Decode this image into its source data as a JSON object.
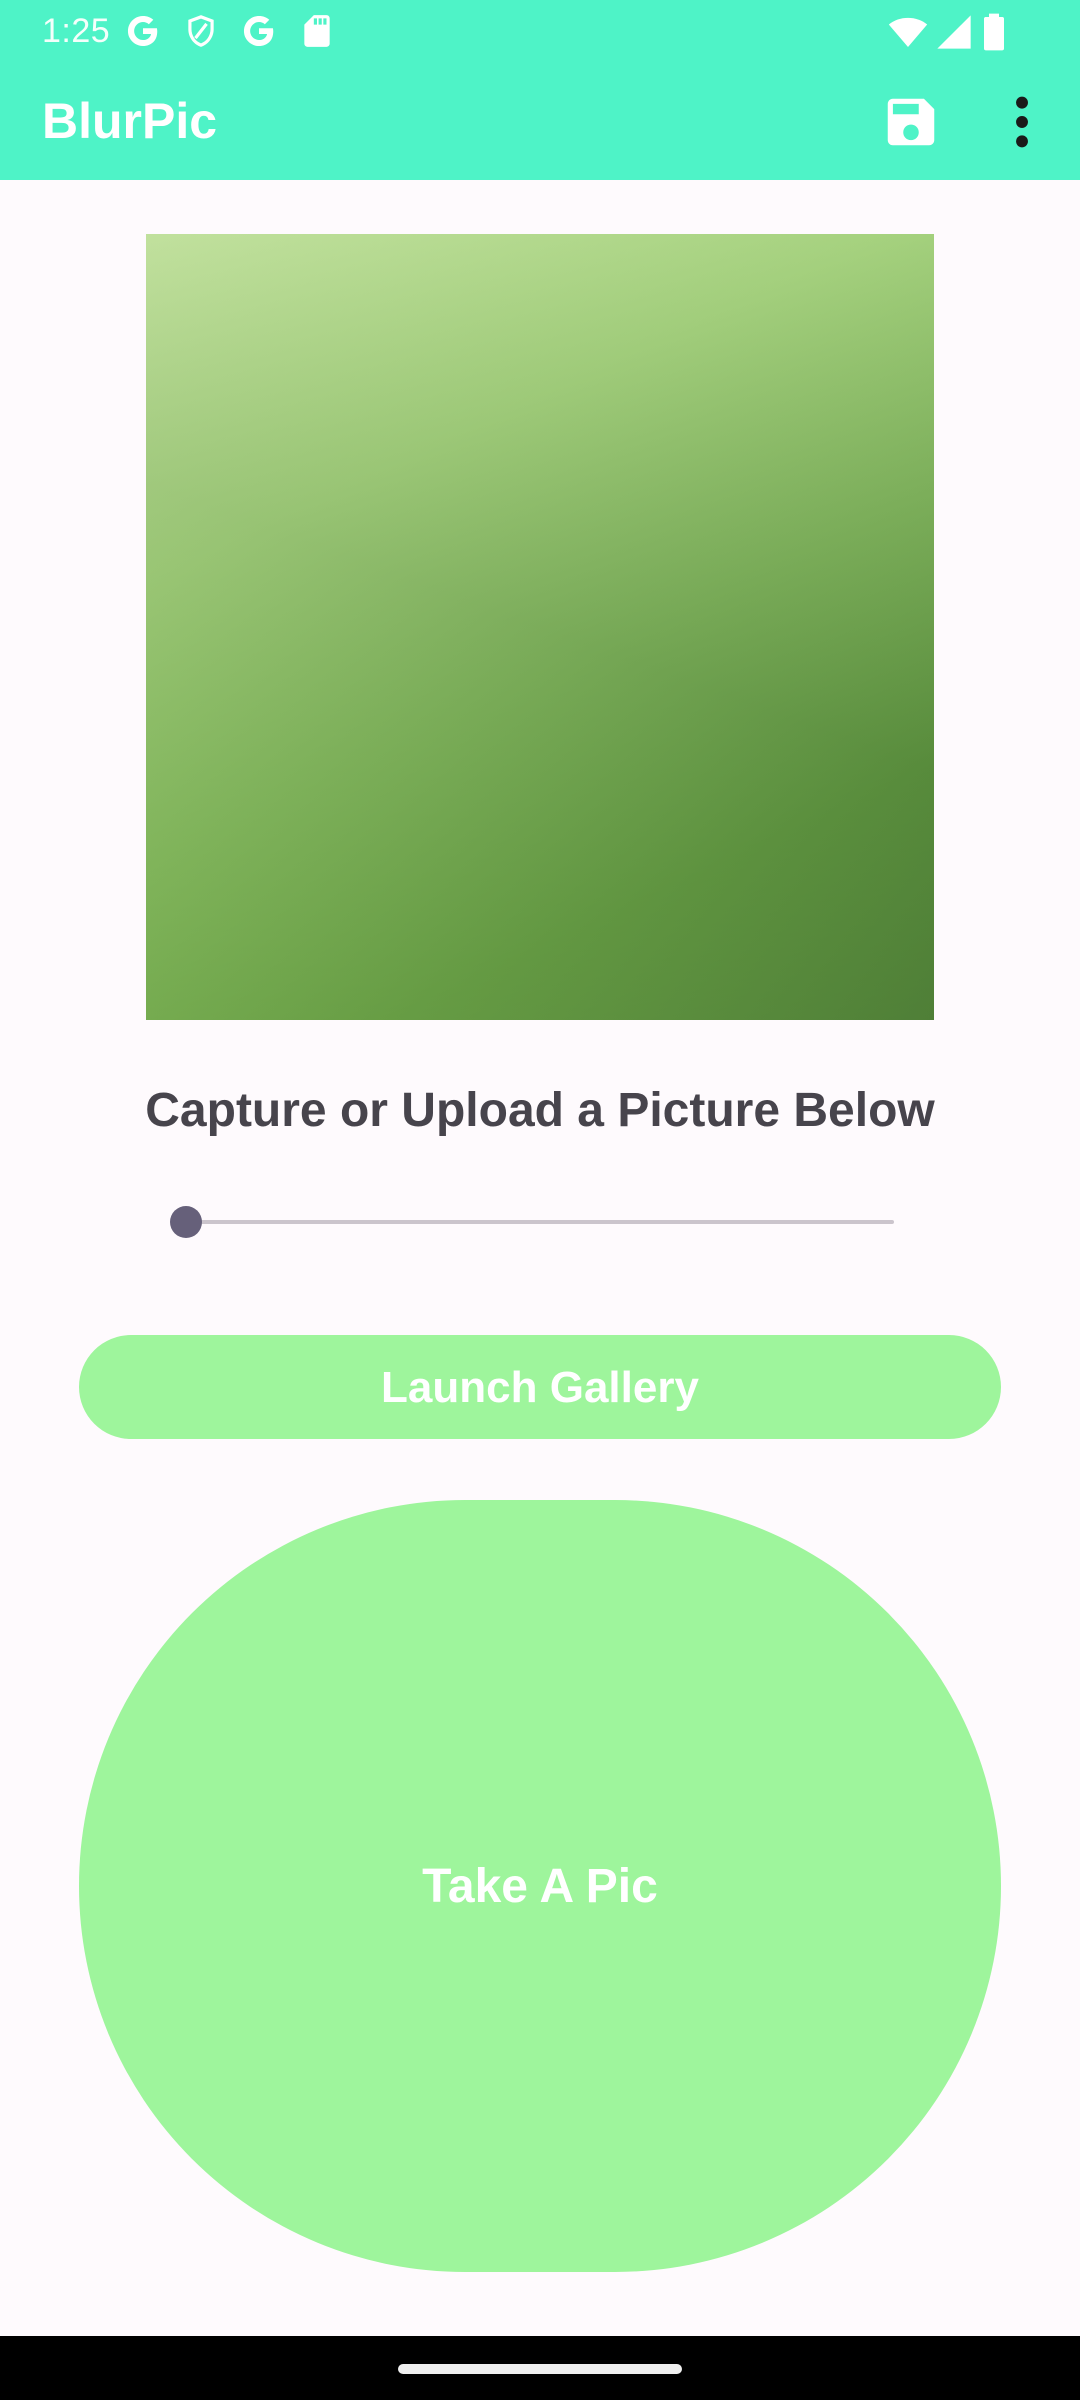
{
  "status_bar": {
    "time": "1:25",
    "left_icons": [
      "google-g-icon",
      "shield-icon",
      "google-g-icon",
      "sd-card-icon"
    ],
    "right_icons": [
      "wifi-icon",
      "cell-signal-icon",
      "battery-icon"
    ],
    "background": "#4ef3c7"
  },
  "app_bar": {
    "title": "BlurPic",
    "actions": [
      "save-icon",
      "more-vert-icon"
    ],
    "background": "#4ef3c7"
  },
  "main": {
    "caption": "Capture or Upload a Picture Below",
    "blur_slider": {
      "value": 0,
      "min": 0,
      "max": 100
    },
    "gallery_button_label": "Launch Gallery",
    "camera_button_label": "Take A Pic",
    "button_color": "#9ef59c"
  }
}
